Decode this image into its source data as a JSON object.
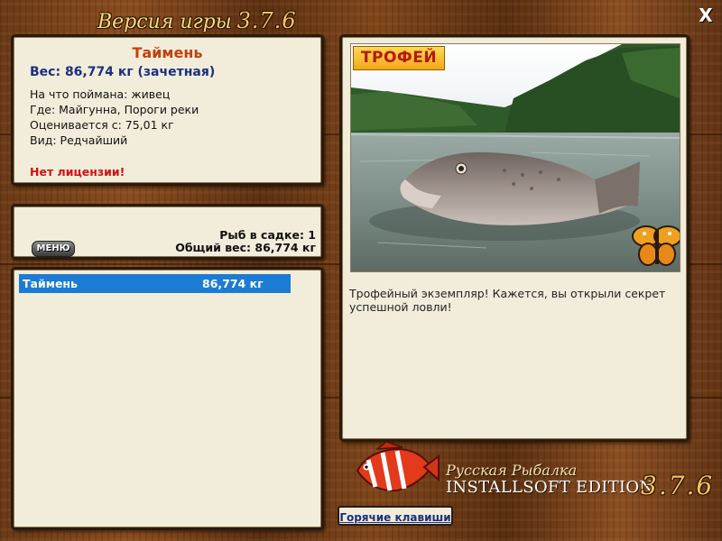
{
  "window": {
    "title": "Версия игры",
    "version": "3.7.6",
    "close_label": "X"
  },
  "fish_info": {
    "name": "Таймень",
    "weight": "Вес: 86,774 кг (зачетная)",
    "bait": "На что поймана: живец",
    "location": "Где: Майгунна, Пороги реки",
    "rated_from": "Оценивается с: 75,01 кг",
    "rarity": "Вид: Редчайший",
    "license_warning": "Нет лицензии!"
  },
  "cage": {
    "menu_label": "МЕНЮ",
    "count": "Рыб в садке: 1",
    "total_weight": "Общий вес: 86,774 кг"
  },
  "catch_list": [
    {
      "name": "Таймень",
      "weight": "86,774 кг",
      "selected": true
    }
  ],
  "trophy": {
    "badge": "ТРОФЕЙ",
    "text": "Трофейный экземпляр! Кажется, вы открыли секрет успешной ловли!"
  },
  "brand": {
    "line1": "Русская Рыбалка",
    "line2": "INSTALLSOFT EDITION",
    "version": "3.7.6"
  },
  "hotkeys_label": "Горячие клавиши",
  "colors": {
    "fish_name": "#c0410a",
    "weight": "#1a2f80",
    "license_warning": "#d21010",
    "selection": "#1c7bd4",
    "panel_bg": "#f2eddb"
  }
}
